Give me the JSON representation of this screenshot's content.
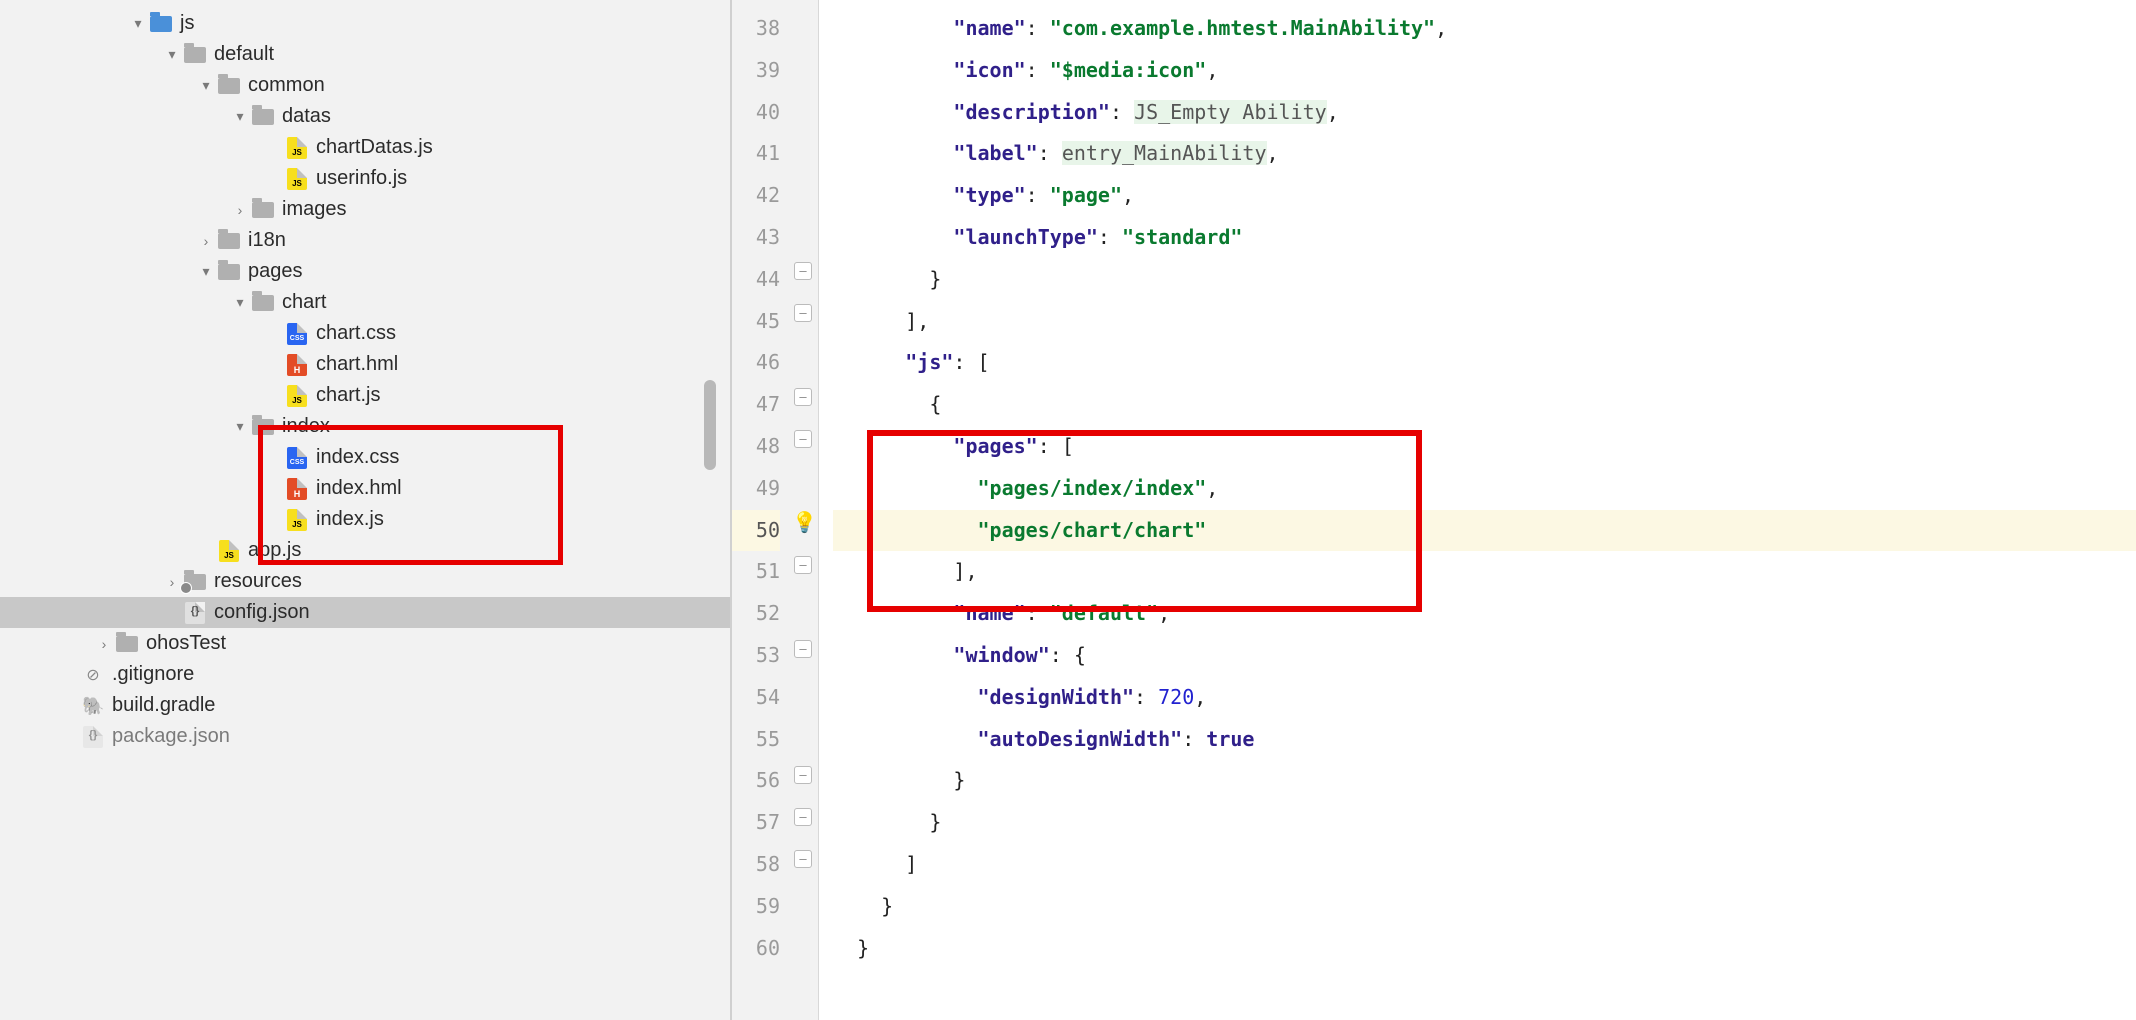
{
  "tree": {
    "js": "js",
    "default": "default",
    "common": "common",
    "datas": "datas",
    "chartDatas": "chartDatas.js",
    "userinfo": "userinfo.js",
    "images": "images",
    "i18n": "i18n",
    "pages": "pages",
    "chart": "chart",
    "chart_css": "chart.css",
    "chart_hml": "chart.hml",
    "chart_js": "chart.js",
    "index": "index",
    "index_css": "index.css",
    "index_hml": "index.hml",
    "index_js": "index.js",
    "app_js": "app.js",
    "resources": "resources",
    "config_json": "config.json",
    "ohosTest": "ohosTest",
    "gitignore": ".gitignore",
    "build_gradle": "build.gradle",
    "package_json": "package.json"
  },
  "lineNumbers": [
    "38",
    "39",
    "40",
    "41",
    "42",
    "43",
    "44",
    "45",
    "46",
    "47",
    "48",
    "49",
    "50",
    "51",
    "52",
    "53",
    "54",
    "55",
    "56",
    "57",
    "58",
    "59",
    "60"
  ],
  "currentLine": "50",
  "code": {
    "l38": {
      "indent": "          ",
      "key": "\"name\"",
      "sep": ": ",
      "val": "\"com.example.hmtest.MainAbility\"",
      "tail": ","
    },
    "l39": {
      "indent": "          ",
      "key": "\"icon\"",
      "sep": ": ",
      "val": "\"$media:icon\"",
      "tail": ","
    },
    "l40": {
      "indent": "          ",
      "key": "\"description\"",
      "sep": ": ",
      "pre": " ",
      "ident": "JS_Empty Ability",
      "tail": ","
    },
    "l41": {
      "indent": "          ",
      "key": "\"label\"",
      "sep": ": ",
      "pre": " ",
      "ident": "entry_MainAbility",
      "tail": ","
    },
    "l42": {
      "indent": "          ",
      "key": "\"type\"",
      "sep": ": ",
      "val": "\"page\"",
      "tail": ","
    },
    "l43": {
      "indent": "          ",
      "key": "\"launchType\"",
      "sep": ": ",
      "val": "\"standard\"",
      "tail": ""
    },
    "l44": {
      "indent": "        ",
      "text": "}"
    },
    "l45": {
      "indent": "      ",
      "text": "],"
    },
    "l46": {
      "indent": "      ",
      "key": "\"js\"",
      "sep": ": ",
      "text": "["
    },
    "l47": {
      "indent": "        ",
      "text": "{"
    },
    "l48": {
      "indent": "          ",
      "key": "\"pages\"",
      "sep": ": ",
      "text": "["
    },
    "l49": {
      "indent": "            ",
      "val": "\"pages/index/index\"",
      "tail": ","
    },
    "l50": {
      "indent": "            ",
      "val": "\"pages/chart/chart\"",
      "tail": ""
    },
    "l51": {
      "indent": "          ",
      "text": "],"
    },
    "l52": {
      "indent": "          ",
      "key": "\"name\"",
      "sep": ": ",
      "val": "\"default\"",
      "tail": ","
    },
    "l53": {
      "indent": "          ",
      "key": "\"window\"",
      "sep": ": ",
      "text": "{"
    },
    "l54": {
      "indent": "            ",
      "key": "\"designWidth\"",
      "sep": ": ",
      "num": "720",
      "tail": ","
    },
    "l55": {
      "indent": "            ",
      "key": "\"autoDesignWidth\"",
      "sep": ": ",
      "bool": "true",
      "tail": ""
    },
    "l56": {
      "indent": "          ",
      "text": "}"
    },
    "l57": {
      "indent": "        ",
      "text": "}"
    },
    "l58": {
      "indent": "      ",
      "text": "]"
    },
    "l59": {
      "indent": "    ",
      "text": "}"
    },
    "l60": {
      "indent": "  ",
      "text": "}"
    }
  }
}
